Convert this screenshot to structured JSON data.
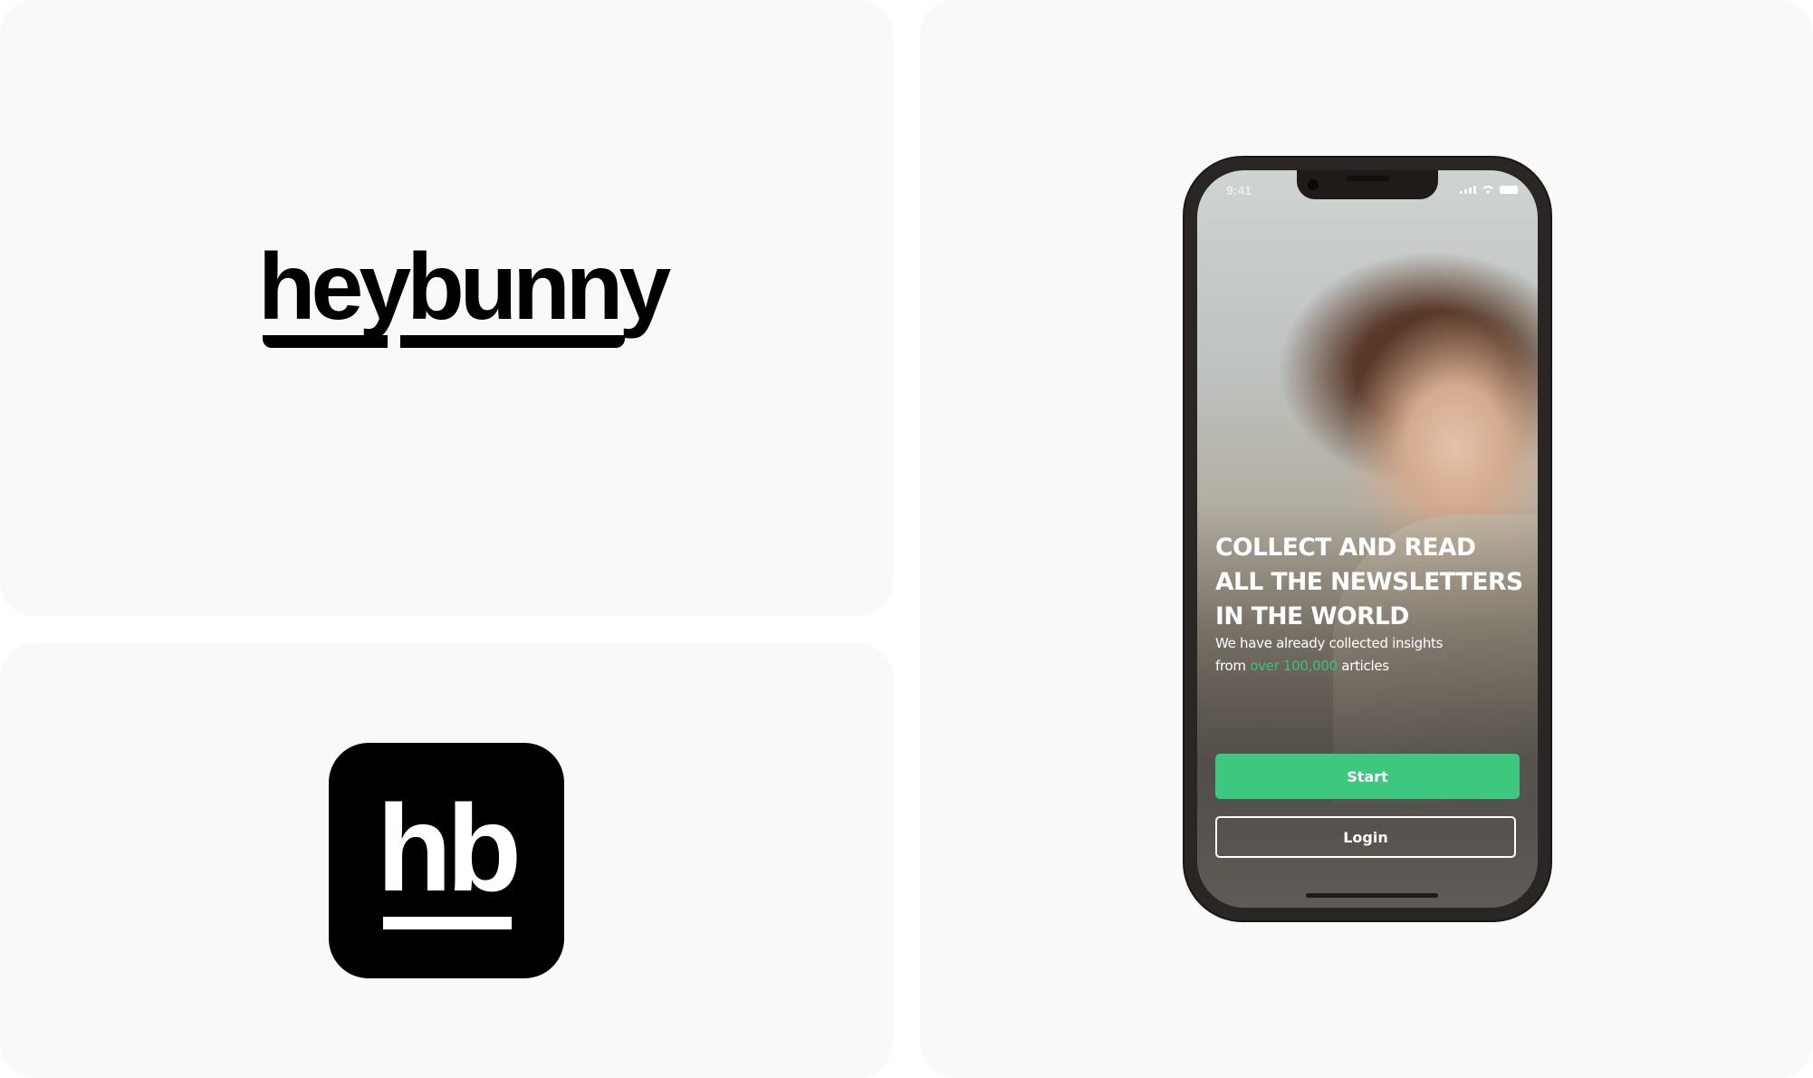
{
  "brand": {
    "wordmark": "heybunny",
    "app_icon_letters": "hb"
  },
  "phone": {
    "status_time": "9:41",
    "headline": [
      "COLLECT AND READ",
      "ALL THE NEWSLETTERS",
      "IN THE WORLD"
    ],
    "subtext": {
      "line1": "We have already collected insights",
      "prefix": "from ",
      "highlight": "over 100,000",
      "suffix": " articles"
    },
    "buttons": {
      "start_label": "Start",
      "login_label": "Login"
    }
  },
  "colors": {
    "panel_background": "#f9f9f9",
    "brand_black": "#000000",
    "accent_green": "#3ec77f",
    "phone_frame": "#2a2624"
  },
  "icons": [
    "signal-icon",
    "wifi-icon",
    "battery-icon"
  ]
}
